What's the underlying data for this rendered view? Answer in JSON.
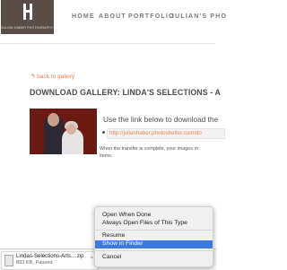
{
  "header": {
    "logo_text": "JULIAN HABER PHOTOGRAPHY",
    "nav": [
      "HOME",
      "ABOUT",
      "PORTFOLIO",
      "JULIAN'S PHO"
    ]
  },
  "page": {
    "back_link": "back to gallery",
    "title": "DOWNLOAD GALLERY: LINDA'S SELECTIONS - A",
    "use_text": "Use the link below to download the",
    "link": "http://julianhaber.photoshelter.com/do",
    "transfer_text": "When the transfer is complete, your images m",
    "transfer_text2": "items."
  },
  "context_menu": {
    "items": [
      "Open When Done",
      "Always Open Files of This Type",
      "Resume",
      "Show in Finder",
      "Cancel"
    ],
    "highlighted": "Show in Finder"
  },
  "download": {
    "filename": "Lindas-Selections-Arts....zip",
    "status": "893 KB, Paused"
  },
  "colors": {
    "accent": "#e8834a",
    "menu_highlight": "#3d7ae0",
    "logo_bg": "#5a4d46"
  }
}
